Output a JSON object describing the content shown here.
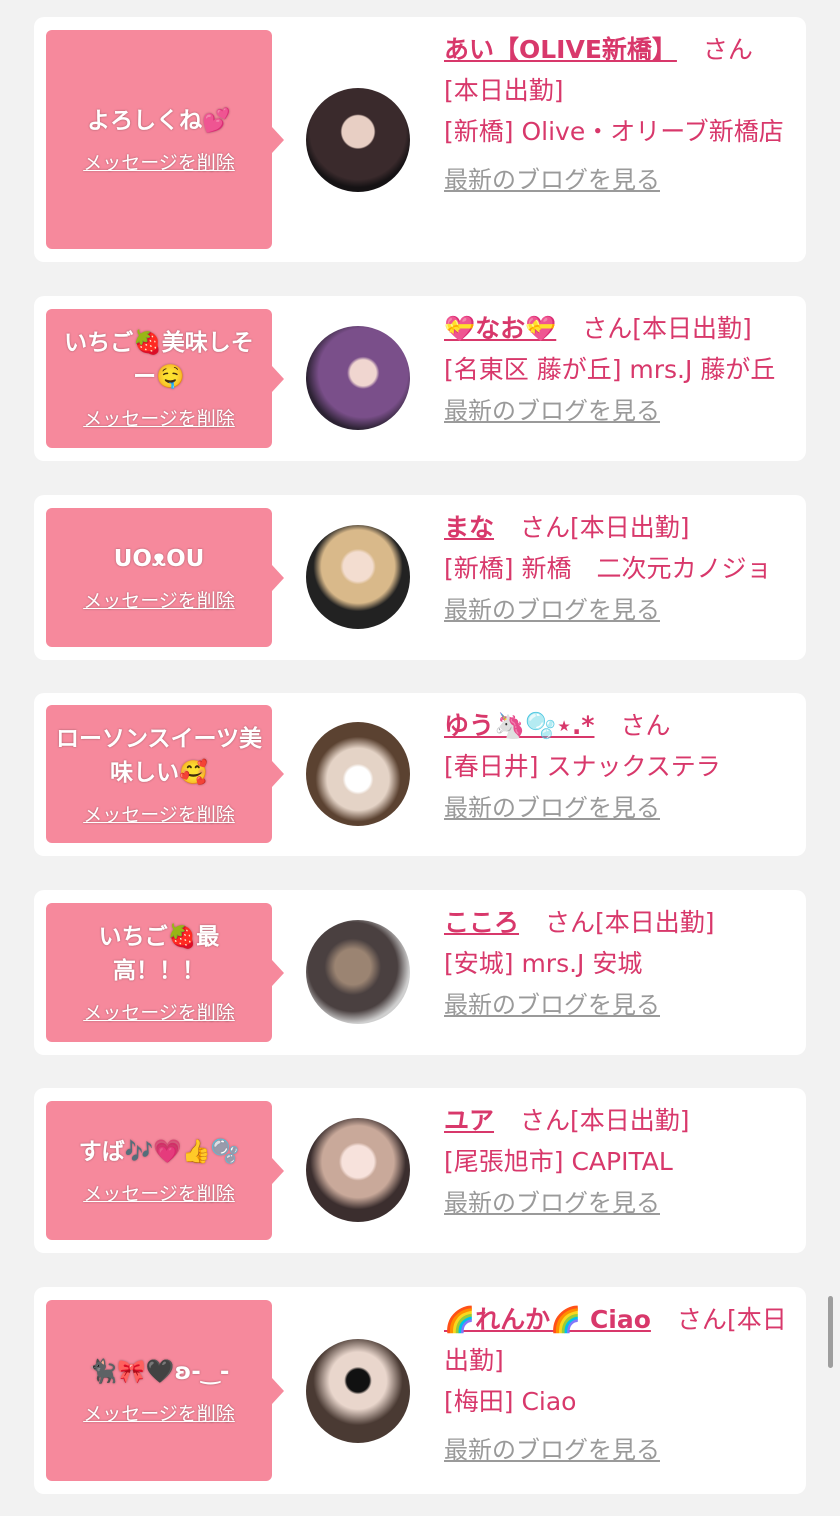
{
  "common": {
    "delete_label": "メッセージを削除",
    "san_label": "さん",
    "blog_label": "最新のブログを見る"
  },
  "cards": [
    {
      "message": "よろしくね💕",
      "name": "あい【OLIVE新橋】",
      "status": "[本日出勤]",
      "shop": "[新橋] Olive・オリーブ新橋店"
    },
    {
      "message": "いちご🍓美味しそー🤤",
      "name": "💝なお💝",
      "status": "[本日出勤]",
      "shop": "[名東区 藤が丘] mrs.J 藤が丘"
    },
    {
      "message": "UOᴥOU",
      "name": "まな",
      "status": "[本日出勤]",
      "shop": "[新橋] 新橋　二次元カノジョ"
    },
    {
      "message": "ローソンスイーツ美味しい🥰",
      "name": "ゆう🦄🫧⋆.*",
      "status": "",
      "shop": "[春日井] スナックステラ"
    },
    {
      "message": "いちご🍓最高！！！",
      "name": "こころ",
      "status": "[本日出勤]",
      "shop": "[安城] mrs.J 安城"
    },
    {
      "message": "すば🎶💗👍🫧",
      "name": "ユア",
      "status": "[本日出勤]",
      "shop": "[尾張旭市] CAPITAL"
    },
    {
      "message": "🐈‍⬛🎀🖤ʚ-‿-",
      "name": "🌈れんか🌈 Ciao",
      "status": "[本日出勤]",
      "shop": "[梅田] Ciao"
    }
  ],
  "colors": {
    "bubble": "#f6899c",
    "accent": "#d8386b",
    "link_gray": "#9a9a9a",
    "background": "#f2f2f2"
  }
}
